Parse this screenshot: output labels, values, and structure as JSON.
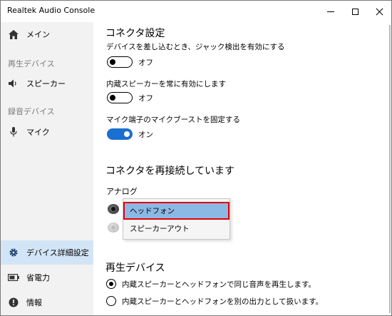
{
  "window": {
    "title": "Realtek Audio Console",
    "controls": {
      "minimize": "minimize-icon",
      "maximize": "maximize-icon",
      "close": "close-icon"
    }
  },
  "sidebar": {
    "main": {
      "label": "メイン",
      "icon": "home-icon"
    },
    "playback_section": "再生デバイス",
    "speaker": {
      "label": "スピーカー",
      "icon": "speaker-icon"
    },
    "recording_section": "録音デバイス",
    "mic": {
      "label": "マイク",
      "icon": "microphone-icon"
    },
    "device_settings": {
      "label": "デバイス詳細設定",
      "icon": "gear-icon",
      "active": true
    },
    "power": {
      "label": "省電力",
      "icon": "battery-icon"
    },
    "info": {
      "label": "情報",
      "icon": "info-icon"
    }
  },
  "connector_settings": {
    "title": "コネクタ設定",
    "options": [
      {
        "label": "デバイスを差し込むとき、ジャック検出を有効にする",
        "state": "オフ",
        "on": false
      },
      {
        "label": "内蔵スピーカーを常に有効にします",
        "state": "オフ",
        "on": false
      },
      {
        "label": "マイク端子のマイクブーストを固定する",
        "state": "オン",
        "on": true
      }
    ]
  },
  "reconnect": {
    "title": "コネクタを再接続しています",
    "analog_label": "アナログ",
    "dropdown_items": [
      "ヘッドフォン",
      "スピーカーアウト"
    ],
    "selected_item": "ヘッドフォン"
  },
  "playback_devices": {
    "title": "再生デバイス",
    "radios": [
      {
        "label": "内蔵スピーカーとヘッドフォンで同じ音声を再生します。",
        "checked": true
      },
      {
        "label": "内蔵スピーカーとヘッドフォンを別の出力として扱います。",
        "checked": false
      }
    ]
  },
  "colors": {
    "accent": "#1a6fd0",
    "active_nav": "#d2e5f6",
    "highlight": "#8cb8e5",
    "highlight_border": "#e00000"
  }
}
